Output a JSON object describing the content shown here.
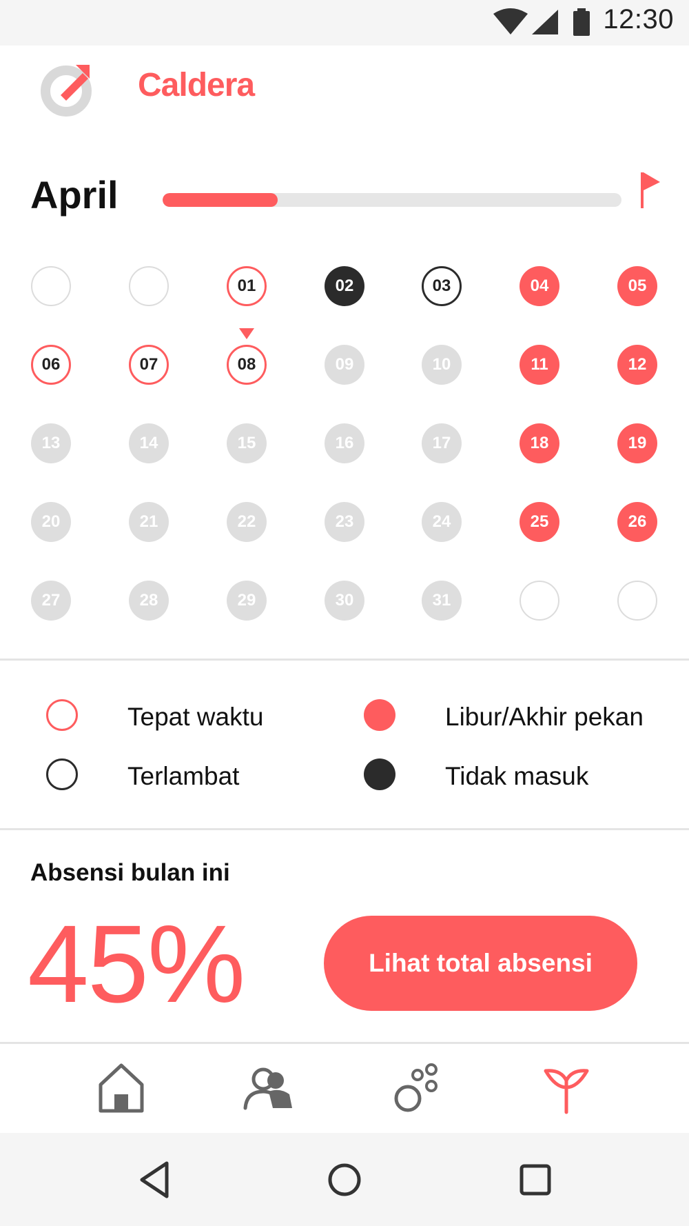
{
  "status_bar": {
    "time": "12:30",
    "icons": [
      "wifi-icon",
      "signal-icon",
      "battery-icon"
    ]
  },
  "app": {
    "name": "Caldera",
    "accent_color": "#fe5c5e",
    "dark_color": "#2b2b2b"
  },
  "month": {
    "name": "April",
    "progress_percent": 25,
    "flag_icon": "flag-icon"
  },
  "calendar": {
    "today": "08",
    "days": [
      {
        "label": "",
        "state": "empty"
      },
      {
        "label": "",
        "state": "empty"
      },
      {
        "label": "01",
        "state": "ontime"
      },
      {
        "label": "02",
        "state": "absent"
      },
      {
        "label": "03",
        "state": "late"
      },
      {
        "label": "04",
        "state": "holiday"
      },
      {
        "label": "05",
        "state": "holiday"
      },
      {
        "label": "06",
        "state": "ontime"
      },
      {
        "label": "07",
        "state": "ontime"
      },
      {
        "label": "08",
        "state": "ontime"
      },
      {
        "label": "09",
        "state": "future"
      },
      {
        "label": "10",
        "state": "future"
      },
      {
        "label": "11",
        "state": "holiday"
      },
      {
        "label": "12",
        "state": "holiday"
      },
      {
        "label": "13",
        "state": "future"
      },
      {
        "label": "14",
        "state": "future"
      },
      {
        "label": "15",
        "state": "future"
      },
      {
        "label": "16",
        "state": "future"
      },
      {
        "label": "17",
        "state": "future"
      },
      {
        "label": "18",
        "state": "holiday"
      },
      {
        "label": "19",
        "state": "holiday"
      },
      {
        "label": "20",
        "state": "future"
      },
      {
        "label": "21",
        "state": "future"
      },
      {
        "label": "22",
        "state": "future"
      },
      {
        "label": "23",
        "state": "future"
      },
      {
        "label": "24",
        "state": "future"
      },
      {
        "label": "25",
        "state": "holiday"
      },
      {
        "label": "26",
        "state": "holiday"
      },
      {
        "label": "27",
        "state": "future"
      },
      {
        "label": "28",
        "state": "future"
      },
      {
        "label": "29",
        "state": "future"
      },
      {
        "label": "30",
        "state": "future"
      },
      {
        "label": "31",
        "state": "future"
      },
      {
        "label": "",
        "state": "empty"
      },
      {
        "label": "",
        "state": "empty"
      }
    ]
  },
  "legend": {
    "on_time": "Tepat waktu",
    "holiday": "Libur/Akhir pekan",
    "late": "Terlambat",
    "absent": "Tidak masuk"
  },
  "summary": {
    "title": "Absensi bulan ini",
    "value": "45%",
    "button_label": "Lihat total absensi"
  },
  "bottom_nav": {
    "items": [
      "home-icon",
      "people-icon",
      "bubbles-icon",
      "sprout-icon"
    ],
    "active": "sprout-icon"
  },
  "system_nav": [
    "back-icon",
    "home-circle-icon",
    "recents-icon"
  ]
}
